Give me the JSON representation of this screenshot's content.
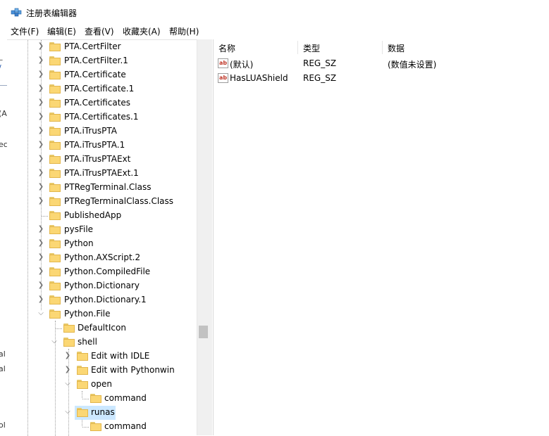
{
  "window": {
    "title": "注册表编辑器"
  },
  "menu": [
    "文件(F)",
    "编辑(E)",
    "查看(V)",
    "收藏夹(A)",
    "帮助(H)"
  ],
  "background_window_fragments": [
    "_",
    "/",
    "(A",
    "ec",
    "al",
    "al",
    "ol"
  ],
  "tree": [
    {
      "label": "PTA.CertFilter"
    },
    {
      "label": "PTA.CertFilter.1"
    },
    {
      "label": "PTA.Certificate"
    },
    {
      "label": "PTA.Certificate.1"
    },
    {
      "label": "PTA.Certificates"
    },
    {
      "label": "PTA.Certificates.1"
    },
    {
      "label": "PTA.iTrusPTA"
    },
    {
      "label": "PTA.iTrusPTA.1"
    },
    {
      "label": "PTA.iTrusPTAExt"
    },
    {
      "label": "PTA.iTrusPTAExt.1"
    },
    {
      "label": "PTRegTerminal.Class"
    },
    {
      "label": "PTRegTerminalClass.Class"
    },
    {
      "label": "PublishedApp"
    },
    {
      "label": "pysFile"
    },
    {
      "label": "Python"
    },
    {
      "label": "Python.AXScript.2"
    },
    {
      "label": "Python.CompiledFile"
    },
    {
      "label": "Python.Dictionary"
    },
    {
      "label": "Python.Dictionary.1"
    },
    {
      "label": "Python.File"
    },
    {
      "label": "DefaultIcon"
    },
    {
      "label": "shell"
    },
    {
      "label": "Edit with IDLE"
    },
    {
      "label": "Edit with Pythonwin"
    },
    {
      "label": "open"
    },
    {
      "label": "command"
    },
    {
      "label": "runas"
    },
    {
      "label": "command"
    }
  ],
  "list": {
    "columns": [
      "名称",
      "类型",
      "数据"
    ],
    "rows": [
      {
        "icon": "ab",
        "name": "(默认)",
        "type": "REG_SZ",
        "data": "(数值未设置)"
      },
      {
        "icon": "ab",
        "name": "HasLUAShield",
        "type": "REG_SZ",
        "data": ""
      }
    ]
  }
}
